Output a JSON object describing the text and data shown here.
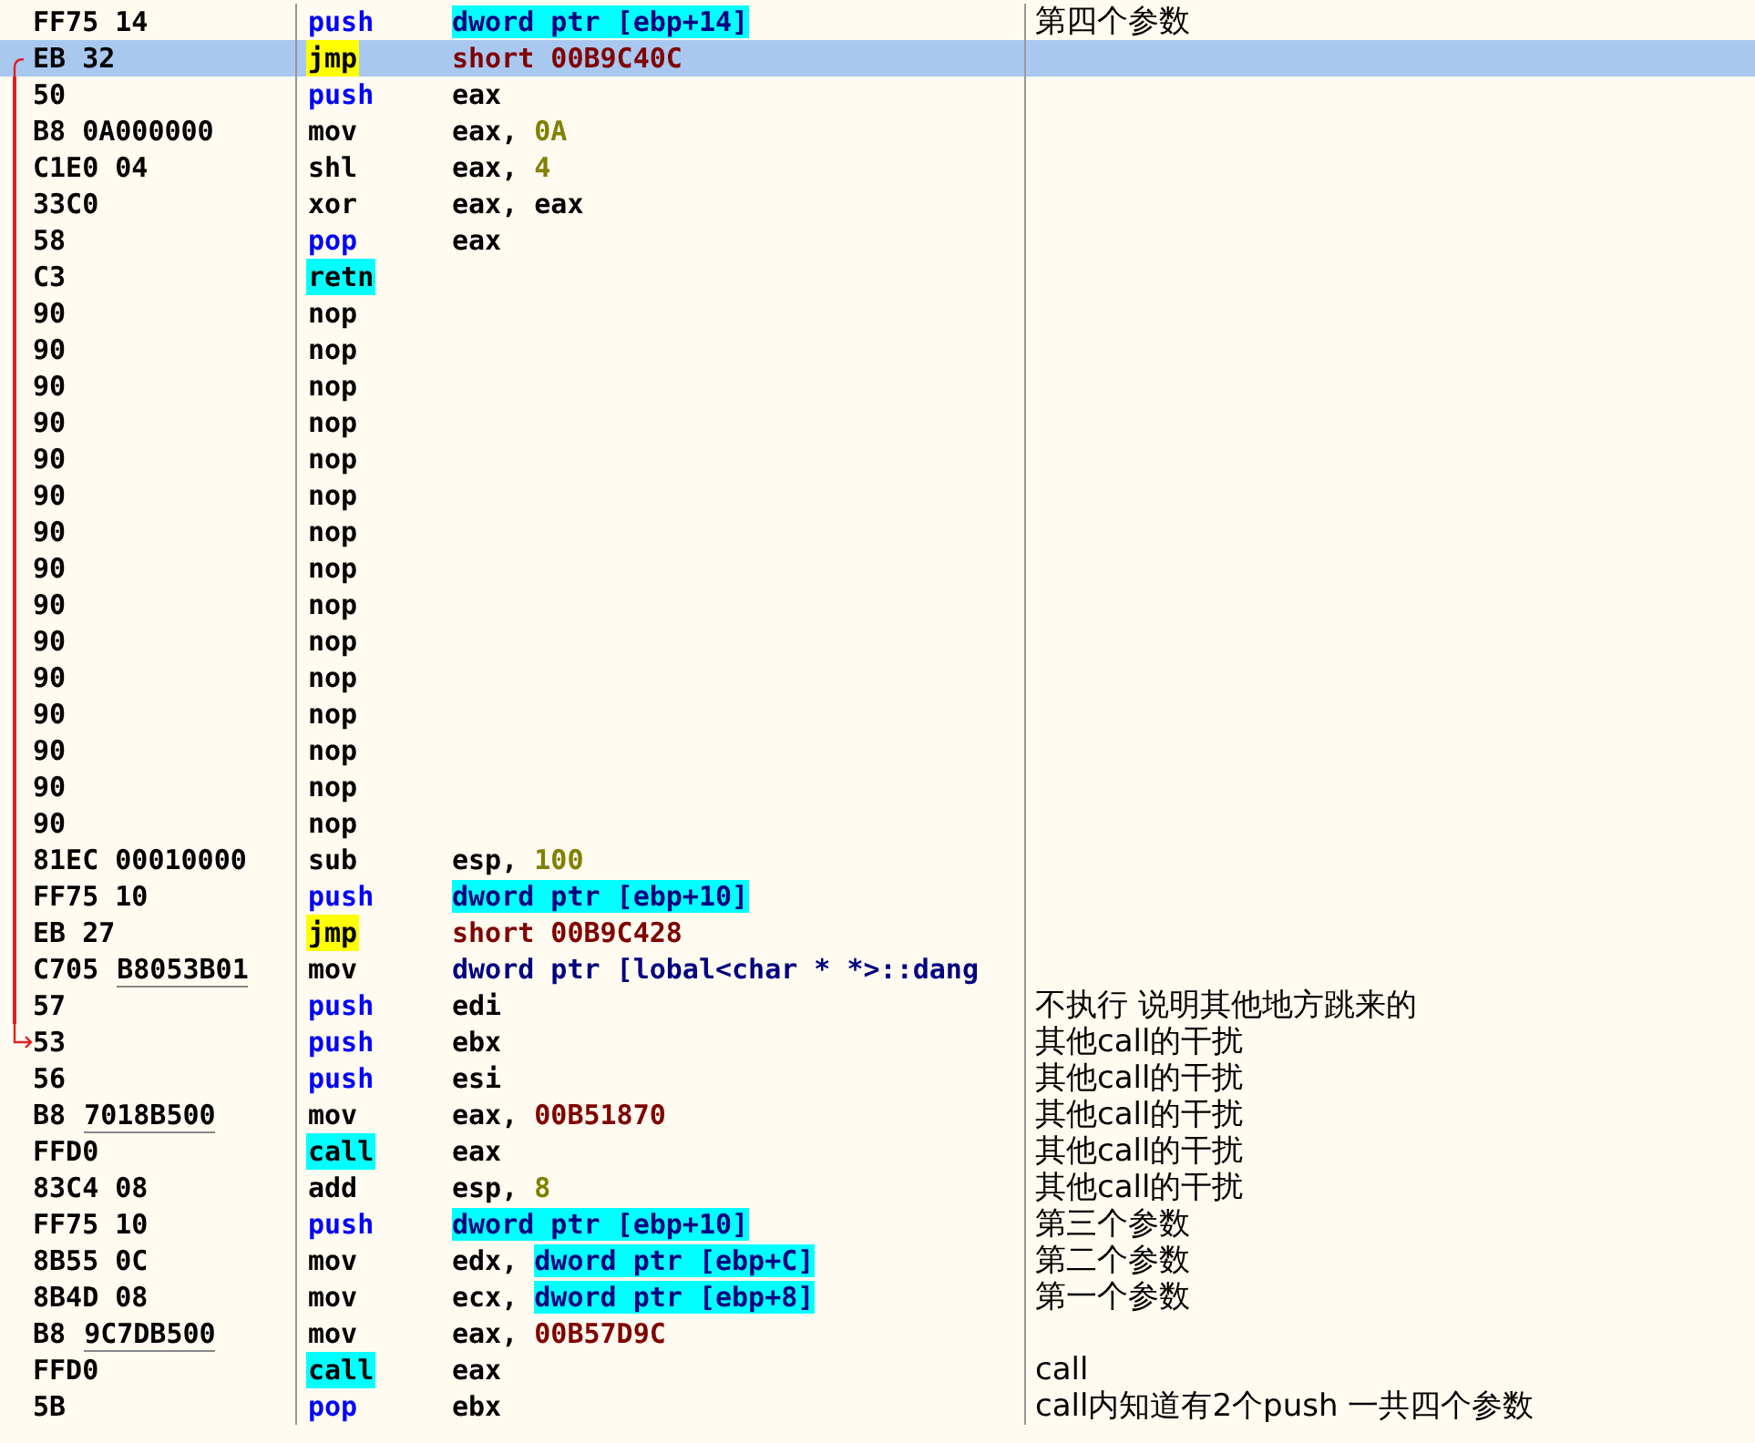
{
  "rows": [
    {
      "hex": "FF75 14",
      "mnemonic": {
        "kind": "stack",
        "text": "push"
      },
      "operand": [
        {
          "kind": "mem",
          "text": "dword ptr [ebp+14]"
        }
      ],
      "comment": "第四个参数",
      "selected": false
    },
    {
      "hex": "EB 32",
      "mnemonic": {
        "kind": "jump",
        "text": "jmp"
      },
      "operand": [
        {
          "kind": "addr",
          "text": "short 00B9C40C"
        }
      ],
      "selected": true,
      "jump_line": {
        "kind": "start"
      }
    },
    {
      "hex": "50",
      "mnemonic": {
        "kind": "stack",
        "text": "push"
      },
      "operand": [
        {
          "kind": "plain",
          "text": "eax"
        }
      ],
      "selected": false,
      "jump_line": {
        "kind": "through"
      }
    },
    {
      "hex": "B8 0A000000",
      "mnemonic": {
        "kind": "plain",
        "text": "mov"
      },
      "operand": [
        {
          "kind": "plain",
          "text": "eax, "
        },
        {
          "kind": "imm",
          "text": "0A"
        }
      ],
      "selected": false,
      "jump_line": {
        "kind": "through"
      }
    },
    {
      "hex": "C1E0 04",
      "mnemonic": {
        "kind": "plain",
        "text": "shl"
      },
      "operand": [
        {
          "kind": "plain",
          "text": "eax, "
        },
        {
          "kind": "imm",
          "text": "4"
        }
      ],
      "selected": false,
      "jump_line": {
        "kind": "through"
      }
    },
    {
      "hex": "33C0",
      "mnemonic": {
        "kind": "plain",
        "text": "xor"
      },
      "operand": [
        {
          "kind": "plain",
          "text": "eax, eax"
        }
      ],
      "selected": false,
      "jump_line": {
        "kind": "through"
      }
    },
    {
      "hex": "58",
      "mnemonic": {
        "kind": "stack",
        "text": "pop"
      },
      "operand": [
        {
          "kind": "plain",
          "text": "eax"
        }
      ],
      "selected": false,
      "jump_line": {
        "kind": "through"
      }
    },
    {
      "hex": "C3",
      "mnemonic": {
        "kind": "call",
        "text": "retn"
      },
      "operand": [],
      "selected": false,
      "jump_line": {
        "kind": "through"
      }
    },
    {
      "hex": "90",
      "mnemonic": {
        "kind": "plain",
        "text": "nop"
      },
      "operand": [],
      "selected": false,
      "jump_line": {
        "kind": "through"
      }
    },
    {
      "hex": "90",
      "mnemonic": {
        "kind": "plain",
        "text": "nop"
      },
      "operand": [],
      "selected": false,
      "jump_line": {
        "kind": "through"
      }
    },
    {
      "hex": "90",
      "mnemonic": {
        "kind": "plain",
        "text": "nop"
      },
      "operand": [],
      "selected": false,
      "jump_line": {
        "kind": "through"
      }
    },
    {
      "hex": "90",
      "mnemonic": {
        "kind": "plain",
        "text": "nop"
      },
      "operand": [],
      "selected": false,
      "jump_line": {
        "kind": "through"
      }
    },
    {
      "hex": "90",
      "mnemonic": {
        "kind": "plain",
        "text": "nop"
      },
      "operand": [],
      "selected": false,
      "jump_line": {
        "kind": "through"
      }
    },
    {
      "hex": "90",
      "mnemonic": {
        "kind": "plain",
        "text": "nop"
      },
      "operand": [],
      "selected": false,
      "jump_line": {
        "kind": "through"
      }
    },
    {
      "hex": "90",
      "mnemonic": {
        "kind": "plain",
        "text": "nop"
      },
      "operand": [],
      "selected": false,
      "jump_line": {
        "kind": "through"
      }
    },
    {
      "hex": "90",
      "mnemonic": {
        "kind": "plain",
        "text": "nop"
      },
      "operand": [],
      "selected": false,
      "jump_line": {
        "kind": "through"
      }
    },
    {
      "hex": "90",
      "mnemonic": {
        "kind": "plain",
        "text": "nop"
      },
      "operand": [],
      "selected": false,
      "jump_line": {
        "kind": "through"
      }
    },
    {
      "hex": "90",
      "mnemonic": {
        "kind": "plain",
        "text": "nop"
      },
      "operand": [],
      "selected": false,
      "jump_line": {
        "kind": "through"
      }
    },
    {
      "hex": "90",
      "mnemonic": {
        "kind": "plain",
        "text": "nop"
      },
      "operand": [],
      "selected": false,
      "jump_line": {
        "kind": "through"
      }
    },
    {
      "hex": "90",
      "mnemonic": {
        "kind": "plain",
        "text": "nop"
      },
      "operand": [],
      "selected": false,
      "jump_line": {
        "kind": "through"
      }
    },
    {
      "hex": "90",
      "mnemonic": {
        "kind": "plain",
        "text": "nop"
      },
      "operand": [],
      "selected": false,
      "jump_line": {
        "kind": "through"
      }
    },
    {
      "hex": "90",
      "mnemonic": {
        "kind": "plain",
        "text": "nop"
      },
      "operand": [],
      "selected": false,
      "jump_line": {
        "kind": "through"
      }
    },
    {
      "hex": "90",
      "mnemonic": {
        "kind": "plain",
        "text": "nop"
      },
      "operand": [],
      "selected": false,
      "jump_line": {
        "kind": "through"
      }
    },
    {
      "hex": "81EC 00010000",
      "mnemonic": {
        "kind": "plain",
        "text": "sub"
      },
      "operand": [
        {
          "kind": "plain",
          "text": "esp, "
        },
        {
          "kind": "imm",
          "text": "100"
        }
      ],
      "selected": false,
      "jump_line": {
        "kind": "through"
      }
    },
    {
      "hex": "FF75 10",
      "mnemonic": {
        "kind": "stack",
        "text": "push"
      },
      "operand": [
        {
          "kind": "mem",
          "text": "dword ptr [ebp+10]"
        }
      ],
      "selected": false,
      "jump_line": {
        "kind": "through"
      }
    },
    {
      "hex": "EB 27",
      "mnemonic": {
        "kind": "jump",
        "text": "jmp"
      },
      "operand": [
        {
          "kind": "addr",
          "text": "short 00B9C428"
        }
      ],
      "selected": false,
      "jump_line": {
        "kind": "through"
      }
    },
    {
      "hex": "C705",
      "reloc": "B8053B01",
      "mnemonic": {
        "kind": "plain",
        "text": "mov"
      },
      "operand": [
        {
          "kind": "sym",
          "text": "dword ptr [lobal<char * *>::dang"
        }
      ],
      "selected": false,
      "jump_line": {
        "kind": "through"
      }
    },
    {
      "hex": "57",
      "mnemonic": {
        "kind": "stack",
        "text": "push"
      },
      "operand": [
        {
          "kind": "plain",
          "text": "edi"
        }
      ],
      "comment": "不执行 说明其他地方跳来的",
      "selected": false,
      "jump_line": {
        "kind": "through"
      }
    },
    {
      "hex": "53",
      "mnemonic": {
        "kind": "stack",
        "text": "push"
      },
      "operand": [
        {
          "kind": "plain",
          "text": "ebx"
        }
      ],
      "comment": "其他call的干扰",
      "selected": false,
      "jump_line": {
        "kind": "end"
      }
    },
    {
      "hex": "56",
      "mnemonic": {
        "kind": "stack",
        "text": "push"
      },
      "operand": [
        {
          "kind": "plain",
          "text": "esi"
        }
      ],
      "comment": "其他call的干扰",
      "selected": false
    },
    {
      "hex": "B8",
      "reloc": "7018B500",
      "mnemonic": {
        "kind": "plain",
        "text": "mov"
      },
      "operand": [
        {
          "kind": "plain",
          "text": "eax, "
        },
        {
          "kind": "addr",
          "text": "00B51870"
        }
      ],
      "comment": "其他call的干扰",
      "selected": false
    },
    {
      "hex": "FFD0",
      "mnemonic": {
        "kind": "call",
        "text": "call"
      },
      "operand": [
        {
          "kind": "plain",
          "text": "eax"
        }
      ],
      "comment": "其他call的干扰",
      "selected": false
    },
    {
      "hex": "83C4 08",
      "mnemonic": {
        "kind": "plain",
        "text": "add"
      },
      "operand": [
        {
          "kind": "plain",
          "text": "esp, "
        },
        {
          "kind": "imm",
          "text": "8"
        }
      ],
      "comment": "其他call的干扰",
      "selected": false
    },
    {
      "hex": "FF75 10",
      "mnemonic": {
        "kind": "stack",
        "text": "push"
      },
      "operand": [
        {
          "kind": "mem",
          "text": "dword ptr [ebp+10]"
        }
      ],
      "comment": "第三个参数",
      "selected": false
    },
    {
      "hex": "8B55 0C",
      "mnemonic": {
        "kind": "plain",
        "text": "mov"
      },
      "operand": [
        {
          "kind": "plain",
          "text": "edx, "
        },
        {
          "kind": "mem",
          "text": "dword ptr [ebp+C]"
        }
      ],
      "comment": "第二个参数",
      "selected": false
    },
    {
      "hex": "8B4D 08",
      "mnemonic": {
        "kind": "plain",
        "text": "mov"
      },
      "operand": [
        {
          "kind": "plain",
          "text": "ecx, "
        },
        {
          "kind": "mem",
          "text": "dword ptr [ebp+8]"
        }
      ],
      "comment": "第一个参数",
      "selected": false
    },
    {
      "hex": "B8",
      "reloc": "9C7DB500",
      "mnemonic": {
        "kind": "plain",
        "text": "mov"
      },
      "operand": [
        {
          "kind": "plain",
          "text": "eax, "
        },
        {
          "kind": "addr",
          "text": "00B57D9C"
        }
      ],
      "selected": false
    },
    {
      "hex": "FFD0",
      "mnemonic": {
        "kind": "call",
        "text": "call"
      },
      "operand": [
        {
          "kind": "plain",
          "text": "eax"
        }
      ],
      "comment": "call",
      "selected": false
    },
    {
      "hex": "5B",
      "mnemonic": {
        "kind": "stack",
        "text": "pop"
      },
      "operand": [
        {
          "kind": "plain",
          "text": "ebx"
        }
      ],
      "comment": "call内知道有2个push 一共四个参数",
      "selected": false
    }
  ]
}
